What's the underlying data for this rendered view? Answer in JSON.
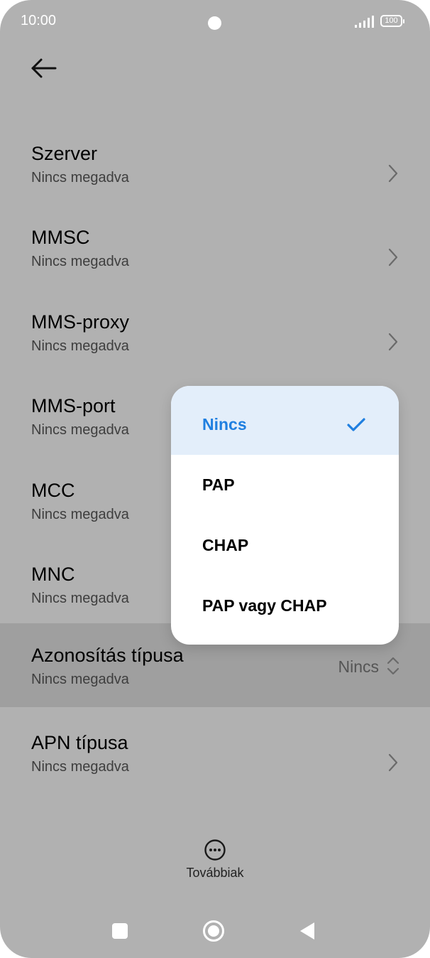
{
  "status_bar": {
    "time": "10:00",
    "battery": "100"
  },
  "rows": [
    {
      "title": "Szerver",
      "subtitle": "Nincs megadva"
    },
    {
      "title": "MMSC",
      "subtitle": "Nincs megadva"
    },
    {
      "title": "MMS-proxy",
      "subtitle": "Nincs megadva"
    },
    {
      "title": "MMS-port",
      "subtitle": "Nincs megadva"
    },
    {
      "title": "MCC",
      "subtitle": "Nincs megadva"
    },
    {
      "title": "MNC",
      "subtitle": "Nincs megadva"
    },
    {
      "title": "Azonosítás típusa",
      "subtitle": "Nincs megadva",
      "value": "Nincs"
    },
    {
      "title": "APN típusa",
      "subtitle": "Nincs megadva"
    }
  ],
  "auth_popup": {
    "options": [
      "Nincs",
      "PAP",
      "CHAP",
      "PAP vagy CHAP"
    ],
    "selected": "Nincs"
  },
  "bottom": {
    "more_label": "Továbbiak"
  },
  "icons": {
    "back": "arrow-left-icon",
    "chevron": "chevron-right-icon",
    "updown": "chevron-up-down-icon",
    "check": "checkmark-icon",
    "more": "more-dots-icon"
  },
  "colors": {
    "dim_background": "#b1b1b1",
    "highlight_row": "#9f9f9f",
    "selected_bg": "#e3eefa",
    "accent": "#1f7fe0"
  }
}
